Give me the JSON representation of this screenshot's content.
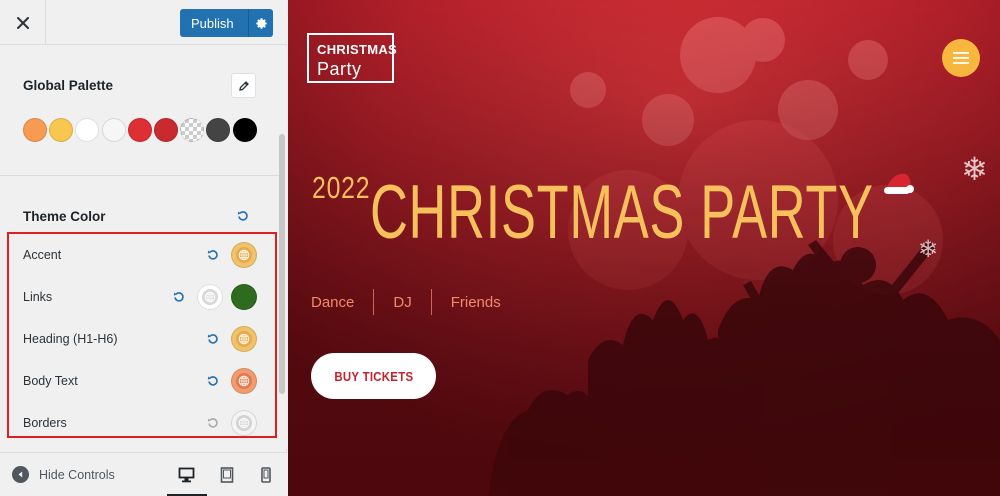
{
  "panel": {
    "close_icon": "close-icon",
    "publish_label": "Publish",
    "global_palette": {
      "title": "Global Palette",
      "swatches": [
        "#f79a52",
        "#f7c750",
        "#ffffff",
        "#f6f6f6",
        "#dd2f34",
        "#c92a2f",
        "transparent",
        "#444444",
        "#000000"
      ]
    },
    "theme_color": {
      "title": "Theme Color",
      "rows": [
        {
          "label": "Accent",
          "color": "#f0c36a",
          "inner": "#e9a94a"
        },
        {
          "label": "Links",
          "color": "#ffffff",
          "inner": "#d8d8d8",
          "second_color": "#2e6b1f"
        },
        {
          "label": "Heading (H1-H6)",
          "color": "#f0c36a",
          "inner": "#e9a94a"
        },
        {
          "label": "Body Text",
          "color": "#f29a70",
          "inner": "#e37a4d"
        },
        {
          "label": "Borders",
          "color": "#f4f4f4",
          "inner": "#d3d3d3"
        }
      ]
    },
    "footer": {
      "hide_controls": "Hide Controls"
    }
  },
  "preview": {
    "logo_line1": "CHRISTMAS",
    "logo_line2": "Party",
    "hero_year": "2022",
    "hero_title": "CHRISTMAS PARTY",
    "tags": [
      "Dance",
      "DJ",
      "Friends"
    ],
    "buy_label": "BUY TICKETS"
  },
  "colors": {
    "publish_blue": "#2271b1",
    "highlight_red": "#e02020",
    "hero_gold": "#f6c05c",
    "menu_gold": "#f7b73f"
  }
}
